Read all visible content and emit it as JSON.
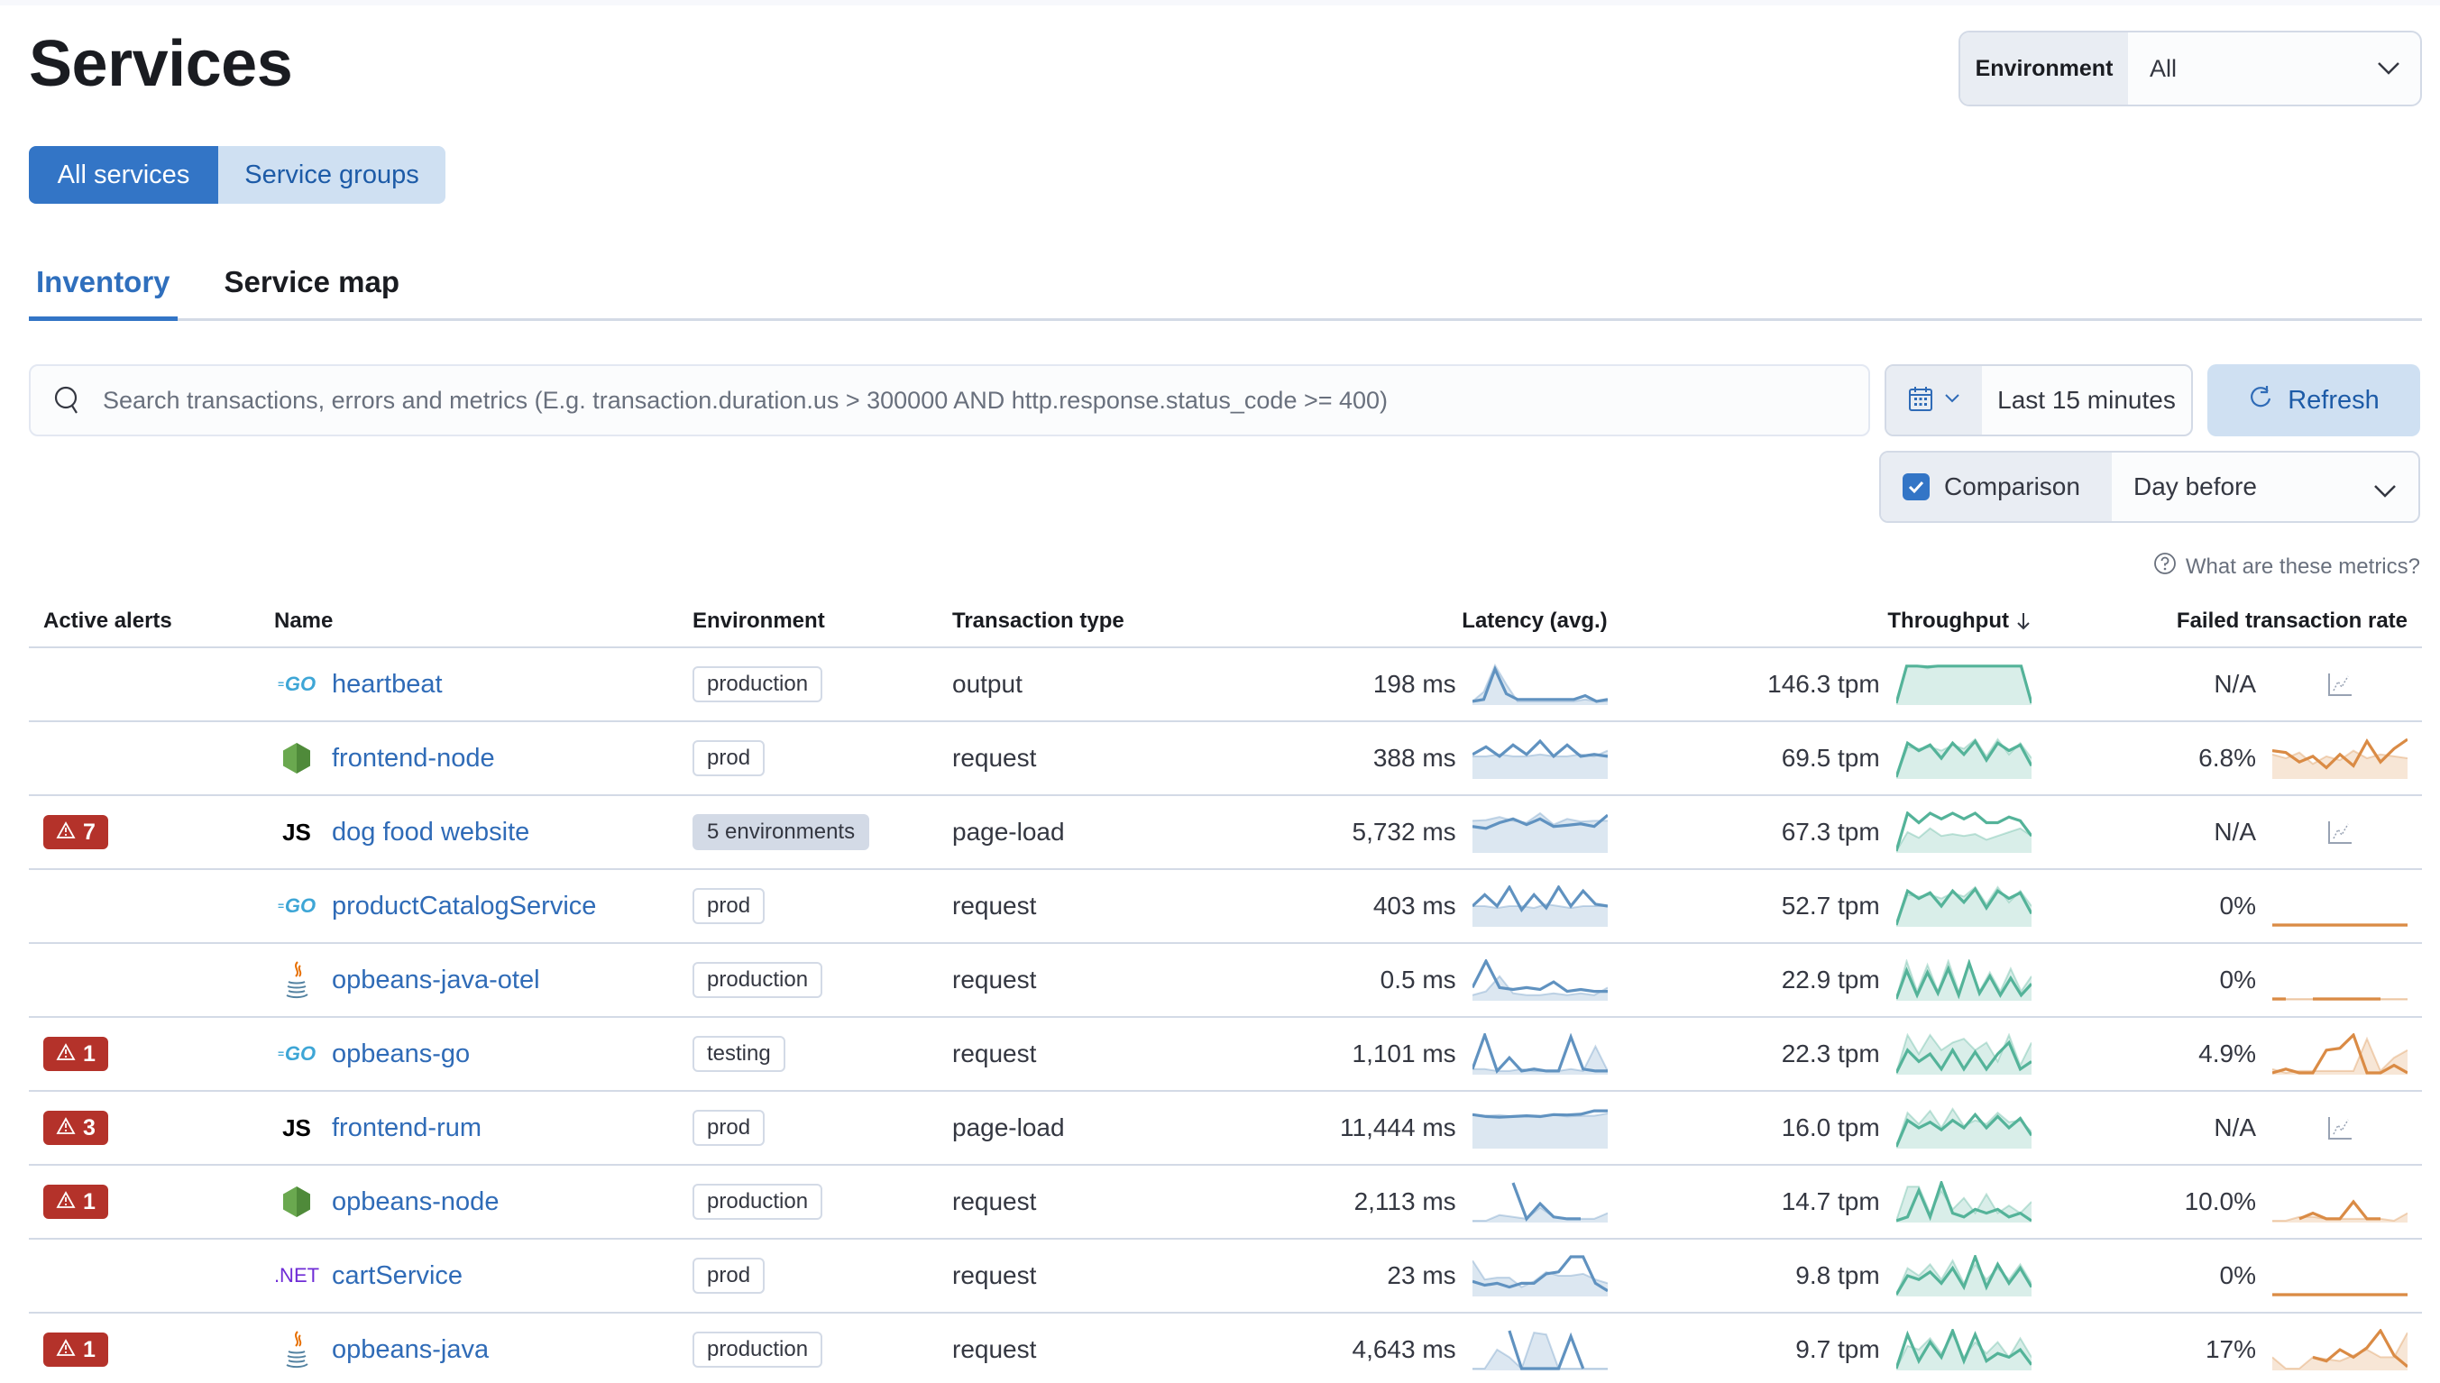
{
  "page": {
    "title": "Services"
  },
  "environment_select": {
    "label": "Environment",
    "value": "All"
  },
  "view_toggle": {
    "all_services": "All services",
    "service_groups": "Service groups"
  },
  "tabs": [
    {
      "label": "Inventory",
      "selected": true
    },
    {
      "label": "Service map",
      "selected": false
    }
  ],
  "search": {
    "placeholder": "Search transactions, errors and metrics (E.g. transaction.duration.us > 300000 AND http.response.status_code >= 400)",
    "value": ""
  },
  "date_picker": {
    "range": "Last 15 minutes",
    "refresh_label": "Refresh"
  },
  "comparison": {
    "label": "Comparison",
    "checked": true,
    "value": "Day before"
  },
  "metrics_help": "What are these metrics?",
  "colors": {
    "primary": "#3375c6",
    "latency": "#6092c0",
    "throughput": "#54b399",
    "failed": "#da8b45",
    "alert": "#b4322a"
  },
  "table": {
    "columns": {
      "active_alerts": "Active alerts",
      "name": "Name",
      "environment": "Environment",
      "transaction_type": "Transaction type",
      "latency": "Latency (avg.)",
      "throughput": "Throughput",
      "failed_rate": "Failed transaction rate"
    },
    "sort": {
      "column": "throughput",
      "direction": "descending"
    },
    "rows": [
      {
        "alerts": "",
        "agent": "go",
        "agent_label": "GO",
        "name": "heartbeat",
        "environment": "production",
        "env_multi": false,
        "type": "output",
        "latency": "198 ms",
        "throughput": "146.3 tpm",
        "failed": "N/A",
        "spark": {
          "lat": [
            0.05,
            0.1,
            0.9,
            0.25,
            0.1,
            0.1,
            0.1,
            0.1,
            0.1,
            0.1,
            0.2,
            0.05,
            0.1
          ],
          "lat_prev": [
            0.05,
            0.3,
            1.0,
            0.5,
            0.05,
            0.05,
            0.05,
            0.05,
            0.05,
            0.05,
            0.1,
            0.05,
            0.05
          ],
          "thr": [
            0.0,
            0.98,
            0.98,
            0.96,
            0.98,
            0.98,
            0.98,
            0.98,
            0.98,
            0.98,
            0.98,
            0.98,
            0.98,
            0.0
          ],
          "thr_prev": [
            0.0,
            0.98,
            0.98,
            0.92,
            0.98,
            0.98,
            0.98,
            0.98,
            0.98,
            0.98,
            0.98,
            0.98,
            0.98,
            0.0
          ],
          "fail": null,
          "fail_prev": null
        }
      },
      {
        "alerts": "",
        "agent": "node",
        "agent_label": "",
        "name": "frontend-node",
        "environment": "prod",
        "env_multi": false,
        "type": "request",
        "latency": "388 ms",
        "throughput": "69.5 tpm",
        "failed": "6.8%",
        "spark": {
          "lat": [
            0.6,
            0.8,
            0.55,
            0.85,
            0.6,
            0.95,
            0.55,
            0.85,
            0.55,
            0.6,
            0.55
          ],
          "lat_prev": [
            0.55,
            0.55,
            0.6,
            0.55,
            0.55,
            0.6,
            0.55,
            0.55,
            0.6,
            0.55,
            0.7
          ],
          "thr": [
            0.0,
            0.9,
            0.7,
            0.85,
            0.5,
            0.9,
            0.6,
            0.95,
            0.45,
            0.9,
            0.7,
            0.85,
            0.3
          ],
          "thr_prev": [
            0.0,
            0.8,
            0.75,
            0.8,
            0.7,
            0.85,
            0.75,
            1.0,
            0.55,
            1.0,
            0.6,
            0.9,
            0.5
          ],
          "fail": [
            0.7,
            0.65,
            0.4,
            0.55,
            0.25,
            0.6,
            0.3,
            0.95,
            0.4,
            0.75,
            1.0
          ],
          "fail_prev": [
            0.6,
            0.5,
            0.65,
            0.35,
            0.55,
            0.45,
            0.7,
            0.5,
            0.6,
            0.55,
            0.5
          ]
        }
      },
      {
        "alerts": "7",
        "agent": "js",
        "agent_label": "JS",
        "name": "dog food website",
        "environment": "5 environments",
        "env_multi": true,
        "type": "page-load",
        "latency": "5,732 ms",
        "throughput": "67.3 tpm",
        "failed": "N/A",
        "spark": {
          "lat": [
            0.65,
            0.6,
            0.75,
            0.85,
            0.7,
            0.85,
            0.65,
            0.68,
            0.72,
            0.65,
            0.95
          ],
          "lat_prev": [
            0.8,
            0.82,
            0.9,
            0.8,
            0.75,
            1.0,
            0.7,
            0.85,
            0.78,
            0.8,
            0.8
          ],
          "thr": [
            0.0,
            1.0,
            0.75,
            1.0,
            0.85,
            1.0,
            0.85,
            1.0,
            0.75,
            0.75,
            0.9,
            0.8,
            0.4
          ],
          "thr_prev": [
            0.0,
            0.5,
            0.35,
            0.6,
            0.4,
            0.45,
            0.4,
            0.45,
            0.3,
            0.4,
            0.5,
            0.6,
            0.4
          ],
          "fail": null,
          "fail_prev": null
        }
      },
      {
        "alerts": "",
        "agent": "go",
        "agent_label": "GO",
        "name": "productCatalogService",
        "environment": "prod",
        "env_multi": false,
        "type": "request",
        "latency": "403 ms",
        "throughput": "52.7 tpm",
        "failed": "0%",
        "spark": {
          "lat": [
            0.5,
            0.8,
            0.5,
            1.0,
            0.4,
            0.8,
            0.45,
            1.0,
            0.5,
            0.9,
            0.55,
            0.5
          ],
          "lat_prev": [
            0.5,
            0.5,
            0.45,
            0.5,
            0.5,
            0.45,
            0.55,
            0.5,
            0.45,
            0.5,
            0.5,
            0.5
          ],
          "thr": [
            0.0,
            0.9,
            0.7,
            0.85,
            0.5,
            0.9,
            0.6,
            0.95,
            0.45,
            0.9,
            0.7,
            0.85,
            0.3
          ],
          "thr_prev": [
            0.0,
            0.8,
            0.75,
            0.8,
            0.7,
            0.85,
            0.75,
            1.0,
            0.55,
            1.0,
            0.6,
            0.9,
            0.5
          ],
          "fail": [
            0,
            0,
            0,
            0,
            0,
            0,
            0,
            0,
            0,
            0,
            0
          ],
          "fail_prev": [
            0,
            0,
            0,
            0,
            0,
            0,
            0,
            0,
            0,
            0,
            0
          ]
        }
      },
      {
        "alerts": "",
        "agent": "java",
        "agent_label": "",
        "name": "opbeans-java-otel",
        "environment": "production",
        "env_multi": false,
        "type": "request",
        "latency": "0.5 ms",
        "throughput": "22.9 tpm",
        "failed": "0%",
        "spark": {
          "lat": [
            0.3,
            1.0,
            0.3,
            0.25,
            0.3,
            0.25,
            0.45,
            0.2,
            0.25,
            0.2,
            0.2
          ],
          "lat_prev": [
            0.1,
            0.2,
            0.6,
            0.15,
            0.1,
            0.1,
            0.15,
            0.1,
            0.15,
            0.1,
            0.3
          ],
          "thr": [
            0.0,
            0.75,
            0.1,
            0.7,
            0.15,
            0.8,
            0.1,
            0.95,
            0.15,
            0.6,
            0.1,
            0.55,
            0.1,
            0.4
          ],
          "thr_prev": [
            0.0,
            1.0,
            0.2,
            0.9,
            0.2,
            1.0,
            0.2,
            0.9,
            0.2,
            0.7,
            0.2,
            0.8,
            0.2,
            0.6
          ],
          "fail": [
            0,
            0,
            null,
            0,
            0,
            0,
            0,
            0,
            0,
            null,
            null
          ],
          "fail_prev": [
            0,
            0,
            0,
            0,
            0,
            0,
            0,
            0,
            0,
            0,
            0
          ]
        }
      },
      {
        "alerts": "1",
        "agent": "go",
        "agent_label": "GO",
        "name": "opbeans-go",
        "environment": "testing",
        "env_multi": false,
        "type": "request",
        "latency": "1,101 ms",
        "throughput": "22.3 tpm",
        "failed": "4.9%",
        "spark": {
          "lat": [
            0.1,
            1.0,
            0.05,
            0.4,
            0.05,
            0.1,
            0.05,
            0.05,
            0.95,
            0.1,
            0.05,
            0.05
          ],
          "lat_prev": [
            0.1,
            0.1,
            0.05,
            0.05,
            0.1,
            0.05,
            0.05,
            0.05,
            0.1,
            0.05,
            0.7,
            0.05
          ],
          "thr": [
            0.0,
            0.6,
            0.3,
            0.5,
            0.1,
            0.6,
            0.1,
            0.55,
            0.1,
            0.5,
            0.8,
            0.1,
            0.3
          ],
          "thr_prev": [
            0.0,
            1.0,
            0.5,
            1.0,
            0.6,
            0.8,
            0.9,
            0.6,
            0.8,
            0.3,
            1.0,
            0.2,
            0.8
          ],
          "fail": [
            0.0,
            0.1,
            0.0,
            0.0,
            0.6,
            0.65,
            1.0,
            0.0,
            0.0,
            0.2,
            0.0
          ],
          "fail_prev": [
            0.1,
            0.0,
            0.05,
            0.05,
            0.05,
            0.05,
            0.05,
            0.9,
            0.05,
            0.4,
            0.6
          ]
        }
      },
      {
        "alerts": "3",
        "agent": "js",
        "agent_label": "JS",
        "name": "frontend-rum",
        "environment": "prod",
        "env_multi": false,
        "type": "page-load",
        "latency": "11,444 ms",
        "throughput": "16.0 tpm",
        "failed": "N/A",
        "spark": {
          "lat": [
            0.85,
            0.8,
            0.78,
            0.8,
            0.82,
            0.8,
            0.85,
            0.84,
            0.86,
            0.95,
            0.95
          ],
          "lat_prev": [
            0.85,
            0.82,
            0.84,
            0.8,
            0.82,
            0.78,
            0.84,
            0.8,
            0.82,
            0.82,
            0.88
          ],
          "thr": [
            0.0,
            0.7,
            0.5,
            0.65,
            0.45,
            0.7,
            0.5,
            0.85,
            0.5,
            0.8,
            0.5,
            0.75,
            0.3
          ],
          "thr_prev": [
            0.0,
            0.9,
            0.6,
            0.95,
            0.5,
            1.0,
            0.55,
            0.7,
            0.6,
            0.9,
            0.65,
            0.7,
            0.4
          ],
          "fail": null,
          "fail_prev": null
        }
      },
      {
        "alerts": "1",
        "agent": "node",
        "agent_label": "",
        "name": "opbeans-node",
        "environment": "production",
        "env_multi": false,
        "type": "request",
        "latency": "2,113 ms",
        "throughput": "14.7 tpm",
        "failed": "10.0%",
        "spark": {
          "lat": [
            null,
            null,
            null,
            1.0,
            0.05,
            0.45,
            0.1,
            0.05,
            0.05,
            null,
            null
          ],
          "lat_prev": [
            0.0,
            0.0,
            0.15,
            0.1,
            0.05,
            0.35,
            0.1,
            0.05,
            0.05,
            0.05,
            0.2
          ],
          "thr": [
            0.0,
            0.1,
            0.8,
            0.1,
            1.0,
            0.2,
            0.1,
            0.3,
            0.2,
            0.3,
            0.1,
            0.2,
            0.0
          ],
          "thr_prev": [
            0.0,
            0.9,
            0.9,
            0.2,
            0.8,
            0.3,
            0.6,
            0.2,
            0.7,
            0.2,
            0.4,
            0.2,
            0.5
          ],
          "fail": [
            null,
            null,
            0.05,
            0.2,
            0.05,
            0.05,
            0.5,
            0.05,
            0.05,
            null,
            null
          ],
          "fail_prev": [
            0.0,
            0.0,
            0.1,
            0.1,
            0.05,
            0.05,
            0.05,
            0.05,
            0.05,
            0.0,
            0.2
          ]
        }
      },
      {
        "alerts": "",
        "agent": "net",
        "agent_label": ".NET",
        "name": "cartService",
        "environment": "prod",
        "env_multi": false,
        "type": "request",
        "latency": "23 ms",
        "throughput": "9.8 tpm",
        "failed": "0%",
        "spark": {
          "lat": [
            0.35,
            0.25,
            0.3,
            0.2,
            0.3,
            0.3,
            0.55,
            0.6,
            1.0,
            1.0,
            0.3,
            0.1
          ],
          "lat_prev": [
            0.9,
            0.4,
            0.45,
            0.45,
            0.2,
            0.35,
            0.6,
            0.5,
            0.5,
            0.55,
            0.4,
            0.3
          ],
          "thr": [
            0.0,
            0.5,
            0.4,
            0.6,
            0.3,
            0.7,
            0.2,
            1.0,
            0.2,
            0.8,
            0.3,
            0.7,
            0.2
          ],
          "thr_prev": [
            0.0,
            0.7,
            0.5,
            0.8,
            0.4,
            0.9,
            0.3,
            0.8,
            0.4,
            0.7,
            0.4,
            0.8,
            0.3
          ],
          "fail": [
            0,
            0,
            0,
            0,
            0,
            0,
            0,
            0,
            0,
            0,
            0
          ],
          "fail_prev": [
            0,
            0,
            0,
            0,
            0,
            0,
            0,
            0,
            0,
            0,
            0
          ]
        }
      },
      {
        "alerts": "1",
        "agent": "java",
        "agent_label": "",
        "name": "opbeans-java",
        "environment": "production",
        "env_multi": false,
        "type": "request",
        "latency": "4,643 ms",
        "throughput": "9.7 tpm",
        "failed": "17%",
        "spark": {
          "lat": [
            null,
            null,
            null,
            1.0,
            0.0,
            0.0,
            0.0,
            0.0,
            0.85,
            0.0,
            null,
            null
          ],
          "lat_prev": [
            0.0,
            0.0,
            0.5,
            0.3,
            0.0,
            0.95,
            0.9,
            0.0,
            0.0,
            0.0,
            0.0,
            0.0
          ],
          "thr": [
            0.0,
            0.9,
            0.2,
            0.7,
            0.3,
            1.0,
            0.2,
            0.9,
            0.2,
            0.4,
            0.3,
            0.5,
            0.1
          ],
          "thr_prev": [
            0.0,
            0.6,
            0.5,
            0.8,
            0.4,
            0.9,
            0.3,
            0.7,
            0.4,
            0.7,
            0.3,
            0.8,
            0.3
          ],
          "fail": [
            null,
            null,
            null,
            0.3,
            0.2,
            0.5,
            0.3,
            0.55,
            1.0,
            0.35,
            0.05
          ],
          "fail_prev": [
            0.3,
            0.0,
            0.0,
            0.3,
            0.25,
            0.2,
            0.35,
            0.5,
            0.3,
            0.3,
            0.95
          ]
        }
      }
    ]
  }
}
